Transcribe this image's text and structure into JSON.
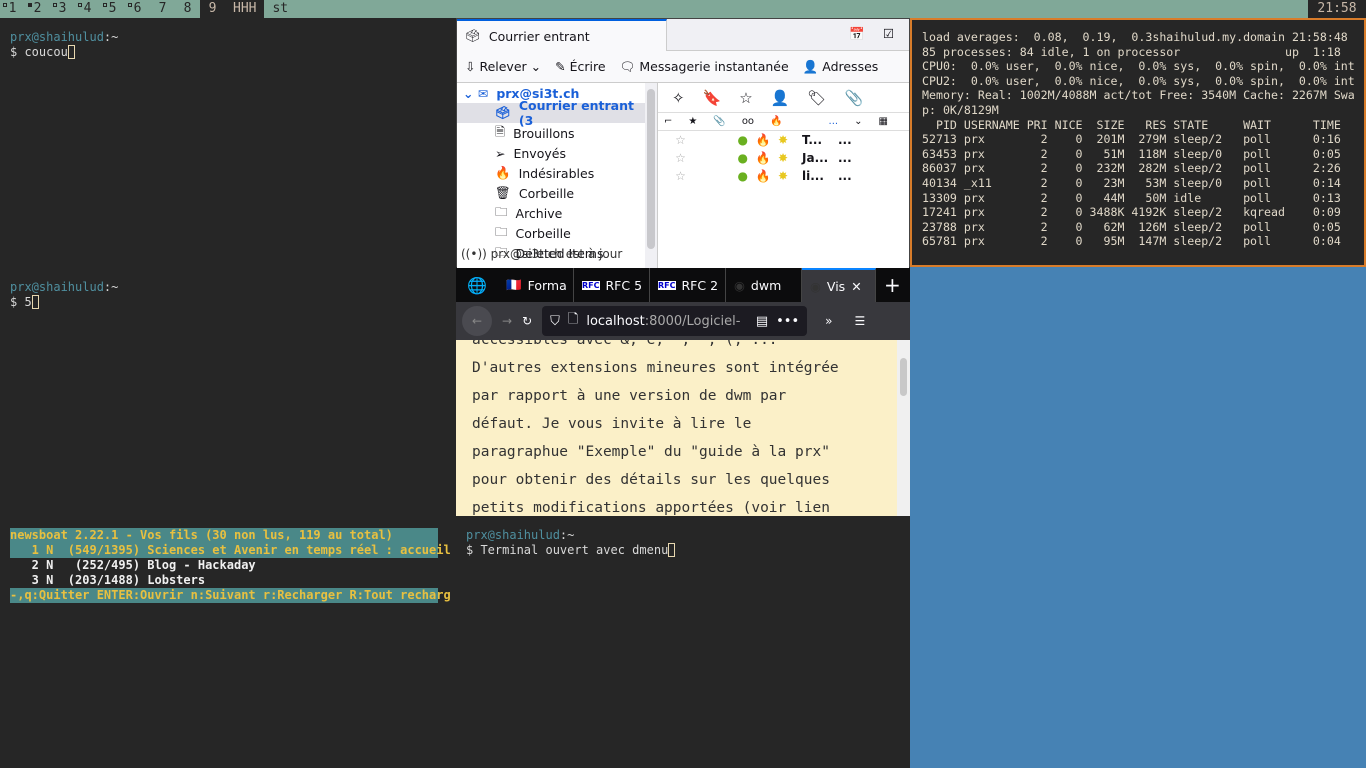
{
  "bar": {
    "tags": [
      {
        "label": "1",
        "dot": "empty"
      },
      {
        "label": "2",
        "dot": "filled"
      },
      {
        "label": "3",
        "dot": "empty"
      },
      {
        "label": "4",
        "dot": "empty"
      },
      {
        "label": "5",
        "dot": "empty"
      },
      {
        "label": "6",
        "dot": "empty"
      },
      {
        "label": "7",
        "dot": ""
      },
      {
        "label": "8",
        "dot": ""
      },
      {
        "label": "9",
        "dot": "",
        "selected": true
      }
    ],
    "layout": "HHH",
    "title": "st",
    "clock": "21:58"
  },
  "term1": {
    "prompt": "prx@shaihulud",
    "path": ":~",
    "cmd": "$ coucou"
  },
  "term2": {
    "prompt": "prx@shaihulud",
    "path": ":~",
    "cmd": "$ 5"
  },
  "term3": {
    "prompt": "prx@shaihulud",
    "path": ":~",
    "cmd": "$ Terminal ouvert avec dmenu"
  },
  "thunderbird": {
    "tab": "Courrier entrant",
    "toolbar": [
      "Relever",
      "Écrire",
      "Messagerie instantanée",
      "Adresses"
    ],
    "account": "prx@si3t.ch",
    "folders": [
      {
        "label": "Courrier entrant (3",
        "icon": "inbox-icon"
      },
      {
        "label": "Brouillons",
        "icon": "draft-icon"
      },
      {
        "label": "Envoyés",
        "icon": "send-icon"
      },
      {
        "label": "Indésirables",
        "icon": "junk-icon"
      },
      {
        "label": "Corbeille",
        "icon": "trash-icon"
      },
      {
        "label": "Archive",
        "icon": "folder-icon"
      },
      {
        "label": "Corbeille",
        "icon": "folder-icon"
      },
      {
        "label": "Deleted Items",
        "icon": "folder-icon"
      }
    ],
    "status": "prx@si3t.ch est à jour",
    "header_more": "...",
    "messages": [
      {
        "subject": "T...",
        "from": "..."
      },
      {
        "subject": "Ja...",
        "from": "..."
      },
      {
        "subject": "li...",
        "from": "..."
      }
    ]
  },
  "top": {
    "lines": [
      "load averages:  0.08,  0.19,  0.3shaihulud.my.domain 21:58:48",
      "85 processes: 84 idle, 1 on processor               up  1:18",
      "CPU0:  0.0% user,  0.0% nice,  0.0% sys,  0.0% spin,  0.0% int",
      "CPU2:  0.0% user,  0.0% nice,  0.0% sys,  0.0% spin,  0.0% int",
      "Memory: Real: 1002M/4088M act/tot Free: 3540M Cache: 2267M Swa",
      "p: 0K/8129M",
      "  PID USERNAME PRI NICE  SIZE   RES STATE     WAIT      TIME",
      "52713 prx        2    0  201M  279M sleep/2   poll      0:16",
      "63453 prx        2    0   51M  118M sleep/0   poll      0:05",
      "86037 prx        2    0  232M  282M sleep/2   poll      2:26",
      "40134 _x11       2    0   23M   53M sleep/0   poll      0:14",
      "13309 prx        2    0   44M   50M idle      poll      0:13",
      "17241 prx        2    0 3488K 4192K sleep/2   kqread    0:09",
      "23788 prx        2    0   62M  126M sleep/2   poll      0:05",
      "65781 prx        2    0   95M  147M sleep/2   poll      0:04"
    ]
  },
  "firefox": {
    "tabs": [
      "Forma",
      "RFC 5",
      "RFC 2",
      "dwm",
      "Vis"
    ],
    "url_host": "localhost",
    "url_rest": ":8000/Logiciel-",
    "content": [
      "accessibles avec &, é, \", ', (, ...",
      "D'autres extensions mineures sont intégrée",
      "par rapport à une version de dwm par",
      "défaut. Je vous invite à lire le",
      "paragraphue \"Exemple\" du \"guide à la prx\"",
      "pour obtenir des détails sur les quelques",
      "petits modifications apportées (voir lien"
    ]
  },
  "newsboat": {
    "header": "newsboat 2.22.1 - Vos fils (30 non lus, 119 au total)",
    "items": [
      "   1 N  (549/1395) Sciences et Avenir en temps réel : accueil",
      "   2 N   (252/495) Blog - Hackaday",
      "   3 N  (203/1488) Lobsters"
    ],
    "footer": "-,q:Quitter ENTER:Ouvrir n:Suivant r:Recharger R:Tout recharg"
  },
  "colors": {
    "bar": "#80a898",
    "desktop": "#4682b4",
    "focus_border": "#d87c2a",
    "newsboat_hl": "#4a8888"
  }
}
